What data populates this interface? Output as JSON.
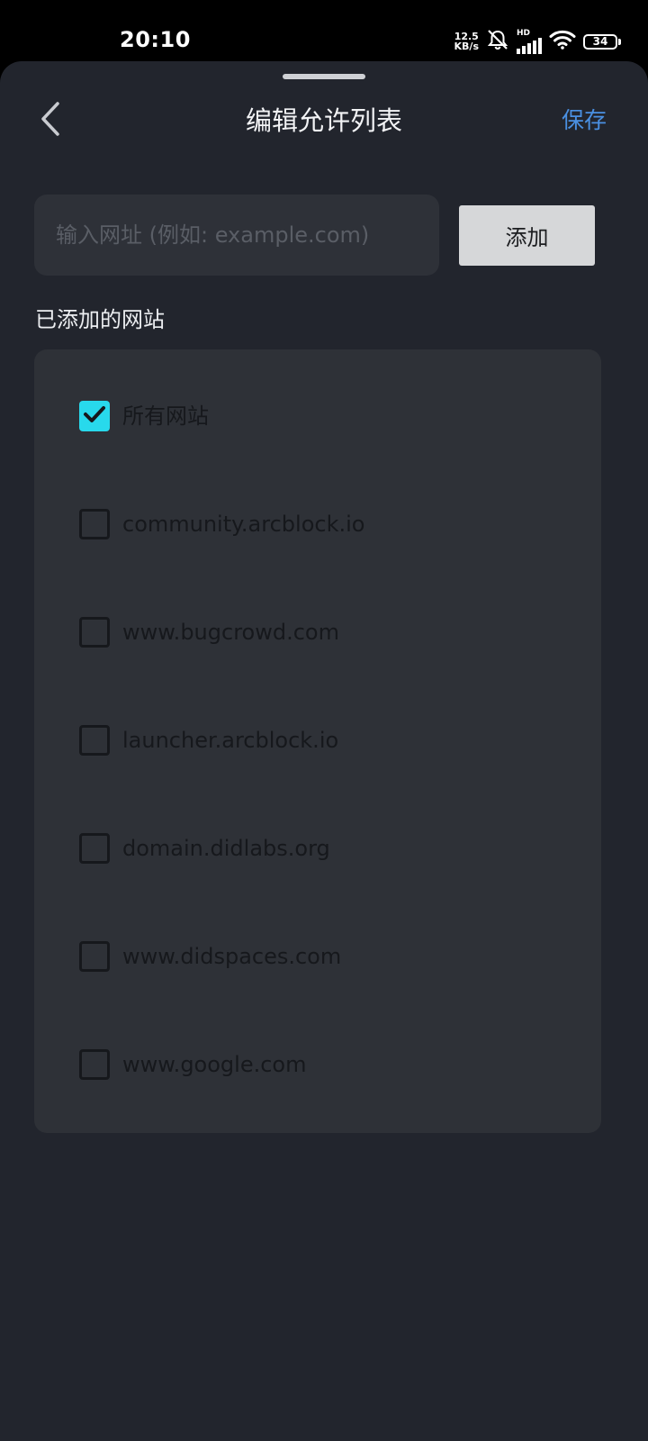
{
  "status_bar": {
    "time": "20:10",
    "net_speed_value": "12.5",
    "net_speed_unit": "KB/s",
    "hd_label": "HD",
    "battery_level": "34"
  },
  "header": {
    "title": "编辑允许列表",
    "save_label": "保存"
  },
  "input": {
    "placeholder": "输入网址 (例如: example.com)",
    "value": ""
  },
  "add_button_label": "添加",
  "section_label": "已添加的网站",
  "sites": [
    {
      "label": "所有网站",
      "checked": true
    },
    {
      "label": "community.arcblock.io",
      "checked": false
    },
    {
      "label": "www.bugcrowd.com",
      "checked": false
    },
    {
      "label": "launcher.arcblock.io",
      "checked": false
    },
    {
      "label": "domain.didlabs.org",
      "checked": false
    },
    {
      "label": "www.didspaces.com",
      "checked": false
    },
    {
      "label": "www.google.com",
      "checked": false
    }
  ],
  "colors": {
    "accent_link": "#4a90e2",
    "checkbox_checked": "#28d9ec",
    "sheet_background": "#22252d"
  }
}
